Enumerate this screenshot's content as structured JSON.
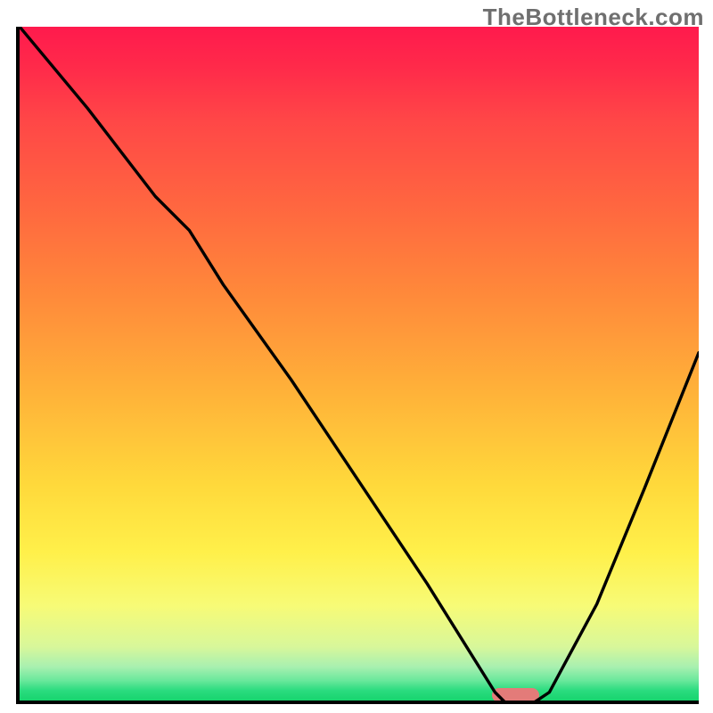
{
  "watermark": "TheBottleneck.com",
  "colors": {
    "axis": "#000000",
    "curve": "#000000",
    "bump": "#e37b79",
    "watermark": "#6f6f6f",
    "gradient_top": "#ff1a4d",
    "gradient_bottom": "#17d46e"
  },
  "chart_data": {
    "type": "line",
    "title": "",
    "xlabel": "",
    "ylabel": "",
    "xlim": [
      0,
      100
    ],
    "ylim": [
      0,
      100
    ],
    "grid": false,
    "legend": false,
    "annotations": [
      {
        "text": "TheBottleneck.com",
        "position": "top-right"
      }
    ],
    "note": "No axis ticks or numeric labels are visible; x/y values are normalized 0–100 estimates read from pixel positions.",
    "series": [
      {
        "name": "bottleneck-curve",
        "x": [
          0,
          10,
          20,
          25,
          30,
          40,
          50,
          60,
          65,
          70,
          72,
          75,
          78,
          85,
          92,
          100
        ],
        "y": [
          100,
          88,
          75,
          70,
          62,
          48,
          33,
          18,
          10,
          2,
          0,
          0,
          2,
          15,
          32,
          52
        ]
      }
    ],
    "marker": {
      "name": "highlight-bump",
      "x_center": 73,
      "y": 0,
      "width_pct": 7
    },
    "background": {
      "type": "vertical-gradient",
      "description": "Red (high) → orange → yellow → light green → green (low), indicating bottleneck severity from top to bottom."
    }
  }
}
